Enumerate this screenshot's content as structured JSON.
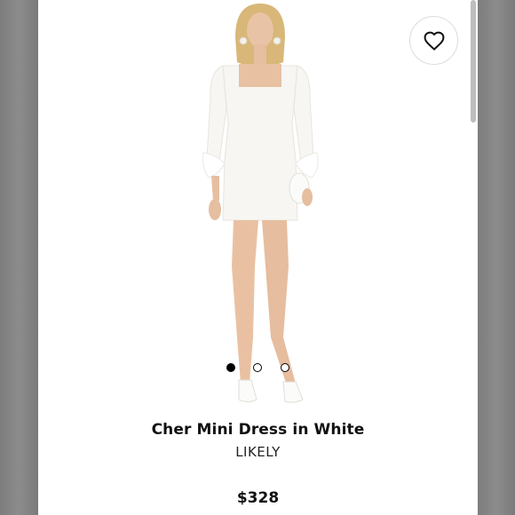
{
  "product": {
    "name": "Cher Mini Dress in White",
    "brand": "LIKELY",
    "price": "$328"
  },
  "carousel": {
    "total_images": 3,
    "active_index": 0
  },
  "icons": {
    "favorite": "heart-outline-icon"
  },
  "colors": {
    "background": "#ffffff",
    "text": "#111111",
    "side_panels": "#868686"
  }
}
